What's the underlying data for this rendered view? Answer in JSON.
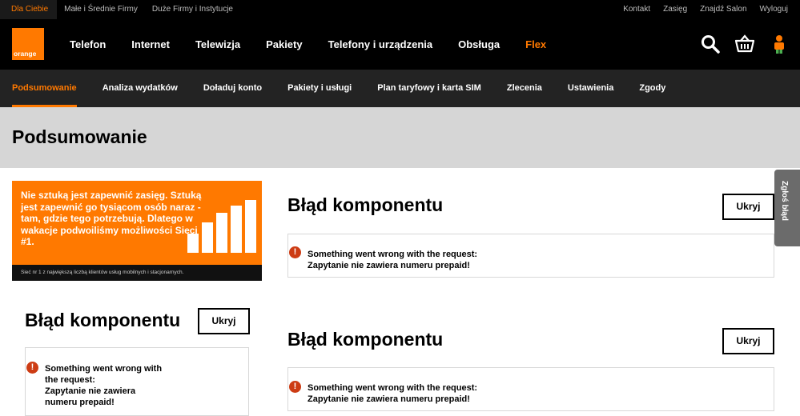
{
  "topbar": {
    "segments": [
      "Dla Ciebie",
      "Małe i Średnie Firmy",
      "Duże Firmy i Instytucje"
    ],
    "links": [
      "Kontakt",
      "Zasięg",
      "Znajdź Salon",
      "Wyloguj"
    ]
  },
  "logo": {
    "text": "orange"
  },
  "mainnav": {
    "items": [
      "Telefon",
      "Internet",
      "Telewizja",
      "Pakiety",
      "Telefony i urządzenia",
      "Obsługa",
      "Flex"
    ]
  },
  "subnav": {
    "items": [
      "Podsumowanie",
      "Analiza wydatków",
      "Doładuj konto",
      "Pakiety i usługi",
      "Plan taryfowy i karta SIM",
      "Zlecenia",
      "Ustawienia",
      "Zgody"
    ]
  },
  "page": {
    "title": "Podsumowanie"
  },
  "banner": {
    "headline": "Nie sztuką jest zapewnić zasięg. Sztuką jest zapewnić go tysiącom osób naraz - tam, gdzie tego potrzebują. Dlatego w wakacje podwoiliśmy możliwości Sieci #1.",
    "footnote": "Sieć nr 1 z największą liczbą klientów usług mobilnych i stacjonarnych."
  },
  "components": [
    {
      "title": "Błąd komponentu",
      "button": "Ukryj",
      "line1": "Something went wrong with the request:",
      "line2": "Zapytanie nie zawiera numeru prepaid!"
    },
    {
      "title": "Błąd komponentu",
      "button": "Ukryj",
      "line1": "Something went wrong with the request:",
      "line2": "Zapytanie nie zawiera numeru prepaid!"
    },
    {
      "title": "Błąd komponentu",
      "button": "Ukryj",
      "line1": "Something went wrong with",
      "line2": "the request:",
      "line3": "Zapytanie nie zawiera",
      "line4": "numeru prepaid!"
    }
  ],
  "feedback": {
    "label": "Zgłoś błąd"
  },
  "colors": {
    "brand": "#ff7900",
    "error": "#cd3c14",
    "black": "#000000",
    "subnav": "#232323",
    "title_band": "#d6d6d6"
  }
}
